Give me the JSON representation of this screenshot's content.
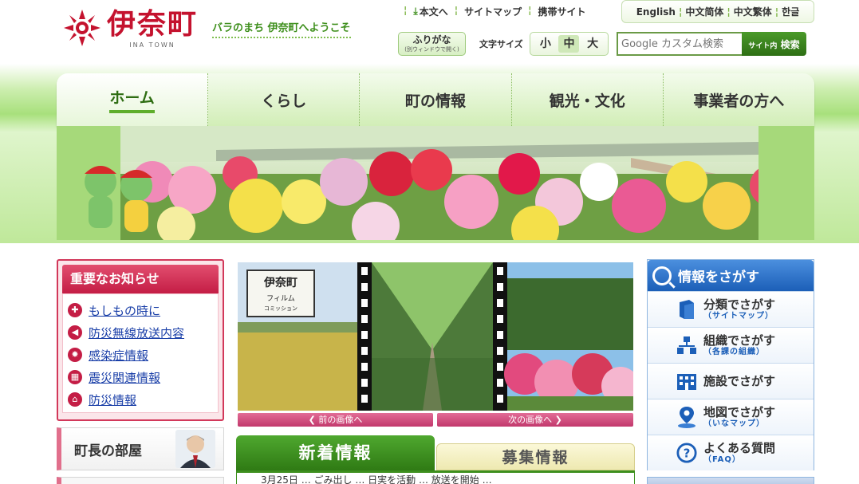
{
  "header": {
    "logo_title": "伊奈町",
    "logo_sub": "INA TOWN",
    "welcome": "バラのまち 伊奈町へようこそ",
    "topnav": [
      "本文へ",
      "サイトマップ",
      "携帯サイト"
    ],
    "languages": [
      "English",
      "中文简体",
      "中文繁体",
      "한글"
    ],
    "furigana_label": "ふりがな",
    "furigana_note": "(別ウィンドウで開く)",
    "fontsize_label": "文字サイズ",
    "fontsize_options": [
      "小",
      "中",
      "大"
    ],
    "fontsize_selected": "中",
    "search_placeholder": "Google カスタム検索",
    "search_button_prefix": "サイト内",
    "search_button": "検索"
  },
  "mainnav": {
    "tabs": [
      "ホーム",
      "くらし",
      "町の情報",
      "観光・文化",
      "事業者の方へ"
    ],
    "active": "ホーム"
  },
  "notice": {
    "title": "重要なお知らせ",
    "items": [
      "もしもの時に",
      "防災無線放送内容",
      "感染症情報",
      "震災関連情報",
      "防災情報"
    ]
  },
  "mayor": {
    "label": "町長の部屋"
  },
  "slideshow": {
    "prev_label": "前の画像へ",
    "next_label": "次の画像へ",
    "film_sign_title": "伊奈町",
    "film_sign_line1": "フィルム",
    "film_sign_line2": "コミッション"
  },
  "news": {
    "tab_news": "新着情報",
    "tab_recruit": "募集情報",
    "first_line": "3月25日 … ごみ出し … 日実を活動 … 放送を開始 …"
  },
  "finder": {
    "title": "情報をさがす",
    "items": [
      {
        "label": "分類でさがす",
        "sub": "（サイトマップ）",
        "icon": "book-icon"
      },
      {
        "label": "組織でさがす",
        "sub": "（各課の組織）",
        "icon": "org-chart-icon"
      },
      {
        "label": "施設でさがす",
        "sub": "",
        "icon": "building-icon"
      },
      {
        "label": "地図でさがす",
        "sub": "（いなマップ）",
        "icon": "map-pin-icon"
      },
      {
        "label": "よくある質問",
        "sub": "（FAQ）",
        "icon": "question-icon"
      }
    ]
  },
  "colors": {
    "brand_red": "#c4122e",
    "nav_green": "#5fae2c",
    "notice_pink": "#d2385a",
    "finder_blue": "#1c5fb8"
  }
}
